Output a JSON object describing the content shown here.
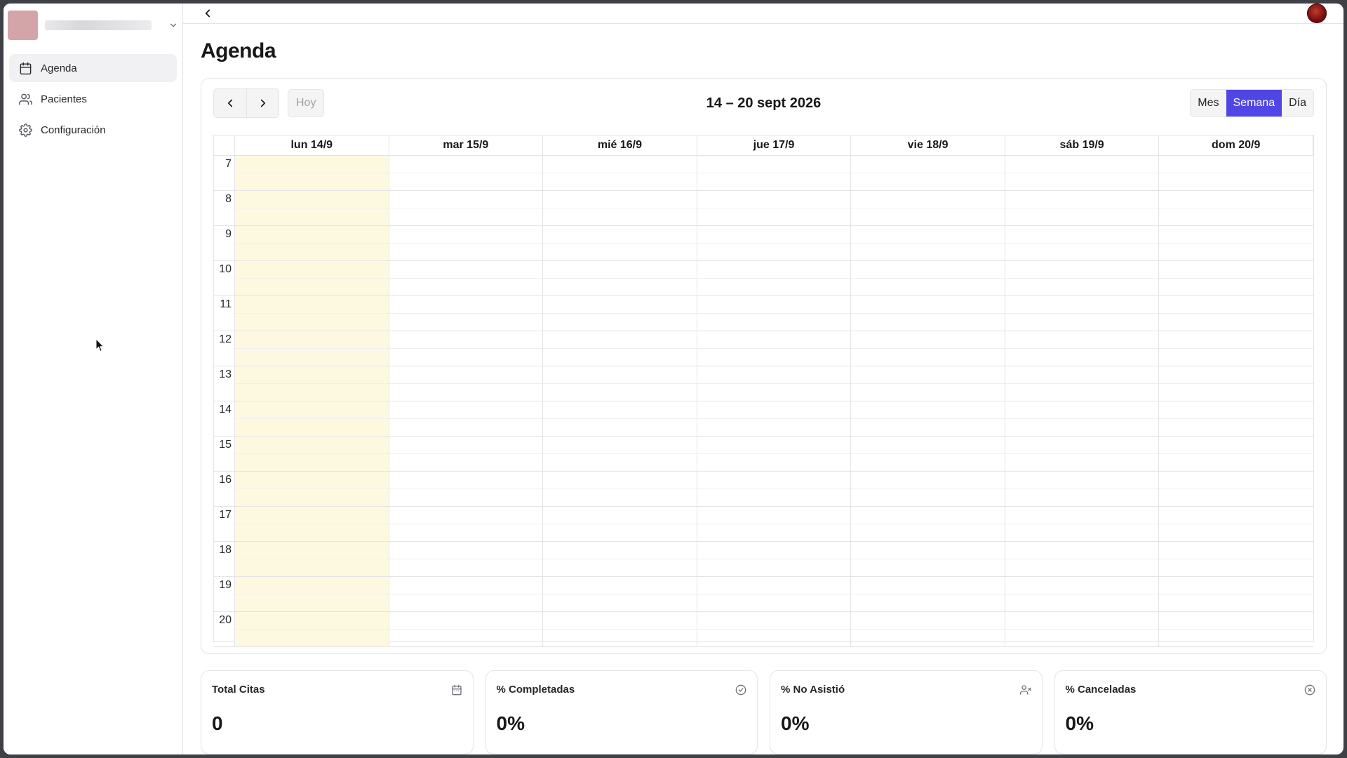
{
  "sidebar": {
    "items": [
      {
        "label": "Agenda",
        "icon": "calendar-icon",
        "active": true
      },
      {
        "label": "Pacientes",
        "icon": "users-icon",
        "active": false
      },
      {
        "label": "Configuración",
        "icon": "gear-icon",
        "active": false
      }
    ]
  },
  "page": {
    "title": "Agenda"
  },
  "calendar": {
    "today_label": "Hoy",
    "range": "14 – 20 sept 2026",
    "views": [
      "Mes",
      "Semana",
      "Día"
    ],
    "active_view": "Semana",
    "days": [
      "lun 14/9",
      "mar 15/9",
      "mié 16/9",
      "jue 17/9",
      "vie 18/9",
      "sáb 19/9",
      "dom 20/9"
    ],
    "hours": [
      "7",
      "8",
      "9",
      "10",
      "11",
      "12",
      "13",
      "14",
      "15",
      "16",
      "17",
      "18",
      "19",
      "20"
    ],
    "highlighted_day_index": 0,
    "accent_color": "#4f46e5",
    "today_color": "#fdf9e1"
  },
  "stats": [
    {
      "title": "Total Citas",
      "value": "0",
      "icon": "calendar-icon"
    },
    {
      "title": "% Completadas",
      "value": "0%",
      "icon": "check-circle-icon"
    },
    {
      "title": "% No Asistió",
      "value": "0%",
      "icon": "user-x-icon"
    },
    {
      "title": "% Canceladas",
      "value": "0%",
      "icon": "x-circle-icon"
    }
  ]
}
